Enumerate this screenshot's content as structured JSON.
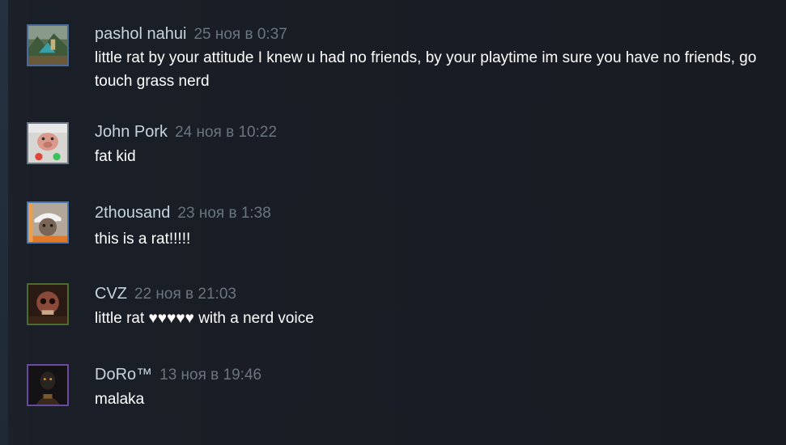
{
  "comments": [
    {
      "author": "pashol nahui",
      "timestamp": "25 ноя в 0:37",
      "text": "little rat by your attitude I knew u had no friends, by your playtime im sure you have no friends, go touch grass nerd",
      "avatar_icon": "landscape-avatar-icon",
      "avatar_border": "#4a6a9c"
    },
    {
      "author": "John Pork",
      "timestamp": "24 ноя в 10:22",
      "text": "fat kid",
      "avatar_icon": "pig-call-avatar-icon",
      "avatar_border": "#6d7a86"
    },
    {
      "author": "2thousand",
      "timestamp": "23 ноя в 1:38",
      "text": "this is a rat!!!!!",
      "avatar_icon": "person-cap-avatar-icon",
      "avatar_border": "#4a7ab5"
    },
    {
      "author": "CVZ",
      "timestamp": "22 ноя в 21:03",
      "text": "little rat ♥♥♥♥♥ with a nerd voice",
      "avatar_icon": "skull-avatar-icon",
      "avatar_border": "#4c6b2f"
    },
    {
      "author": "DoRo™",
      "timestamp": "13 ноя в 19:46",
      "text": "malaka",
      "avatar_icon": "dark-figure-avatar-icon",
      "avatar_border": "#6a4aa0"
    }
  ]
}
